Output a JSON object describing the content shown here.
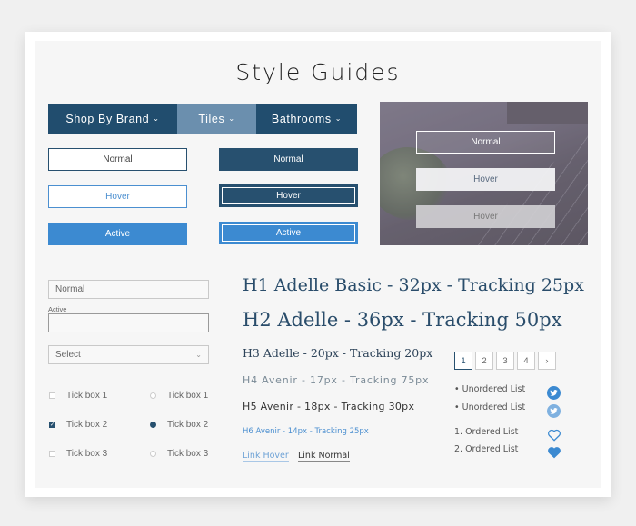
{
  "page": {
    "title": "Style Guides"
  },
  "nav": {
    "items": [
      {
        "label": "Shop By Brand",
        "chevron": "chevron-down-icon",
        "state": "normal"
      },
      {
        "label": "Tiles",
        "chevron": "chevron-down-icon",
        "state": "hover"
      },
      {
        "label": "Bathrooms",
        "chevron": "chevron-down-icon",
        "state": "normal"
      }
    ]
  },
  "buttons": {
    "outline": {
      "normal": "Normal",
      "hover": "Hover",
      "active": "Active"
    },
    "filled": {
      "normal": "Normal",
      "hover": "Hover",
      "active": "Active"
    },
    "photo": {
      "normal": "Normal",
      "hover": "Hover",
      "hover_alt": "Hover"
    }
  },
  "forms": {
    "normal_input_value": "Normal",
    "active_label": "Active",
    "active_input_value": "",
    "select_value": "Select",
    "checkboxes": [
      {
        "label": "Tick box 1",
        "checked": false
      },
      {
        "label": "Tick box 2",
        "checked": true
      },
      {
        "label": "Tick box 3",
        "checked": false
      }
    ],
    "radios": [
      {
        "label": "Tick box 1",
        "checked": false
      },
      {
        "label": "Tick box 2",
        "checked": true
      },
      {
        "label": "Tick box 3",
        "checked": false
      }
    ]
  },
  "typography": {
    "h1": "H1 Adelle Basic - 32px - Tracking 25px",
    "h2": "H2 Adelle - 36px - Tracking 50px",
    "h3": "H3 Adelle - 20px - Tracking 20px",
    "h4": "H4 Avenir - 17px - Tracking 75px",
    "h5": "H5 Avenir - 18px - Tracking 30px",
    "h6": "H6 Avenir - 14px - Tracking 25px",
    "link_hover": "Link Hover",
    "link_normal": "Link Normal"
  },
  "pagination": {
    "pages": [
      "1",
      "2",
      "3",
      "4"
    ],
    "current": "1",
    "next": "›"
  },
  "lists": {
    "unordered": [
      "• Unordered List",
      "• Unordered List"
    ],
    "ordered": [
      "1. Ordered List",
      "2. Ordered List"
    ]
  },
  "icons": {
    "twitter_1": "twitter-icon",
    "twitter_2": "twitter-icon",
    "heart_outline": "heart-outline-icon",
    "heart_filled": "heart-filled-icon"
  },
  "colors": {
    "primary_dark": "#214d6e",
    "nav_hover": "#6b8fae",
    "accent_blue": "#3c8ad1",
    "panel_bg": "#f6f6f6"
  }
}
